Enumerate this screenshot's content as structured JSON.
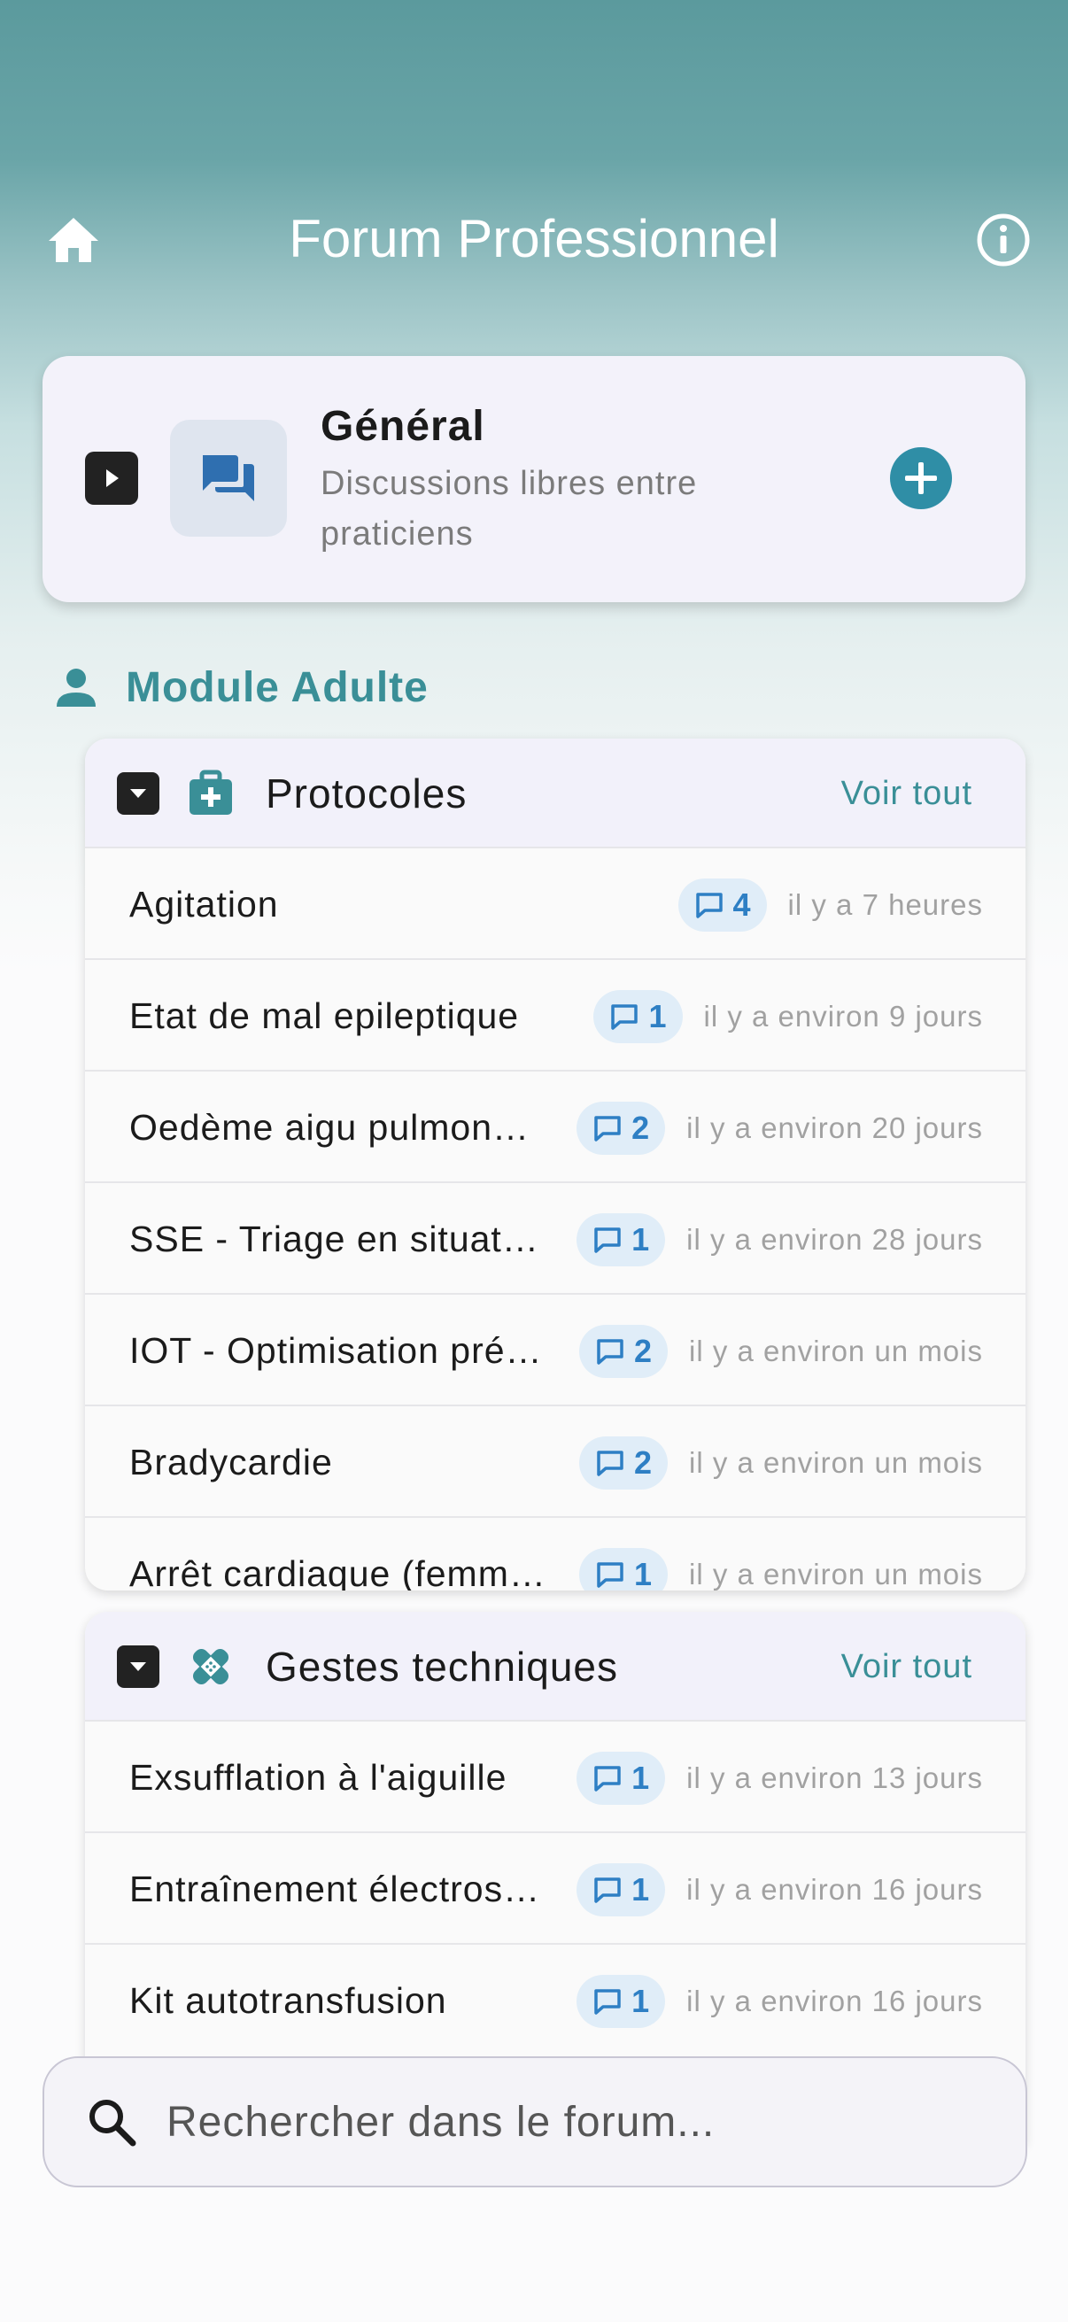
{
  "header": {
    "title": "Forum Professionnel"
  },
  "general": {
    "title": "Général",
    "description": "Discussions libres entre praticiens"
  },
  "module": {
    "title": "Module Adulte"
  },
  "protocols": {
    "title": "Protocoles",
    "see_all": "Voir tout",
    "topics": [
      {
        "title": "Agitation",
        "replies": "4",
        "time": "il y a 7 heures"
      },
      {
        "title": "Etat de mal epileptique",
        "replies": "1",
        "time": "il y a environ 9 jours"
      },
      {
        "title": "Oedème aigu pulmonaire",
        "replies": "2",
        "time": "il y a environ 20 jours"
      },
      {
        "title": "SSE - Triage en situation",
        "replies": "1",
        "time": "il y a environ 28 jours"
      },
      {
        "title": "IOT - Optimisation pré-oxygénation",
        "replies": "2",
        "time": "il y a environ un mois"
      },
      {
        "title": "Bradycardie",
        "replies": "2",
        "time": "il y a environ un mois"
      },
      {
        "title": "Arrêt cardiaque (femme enceinte)",
        "replies": "1",
        "time": "il y a environ un mois"
      }
    ]
  },
  "gestures": {
    "title": "Gestes techniques",
    "see_all": "Voir tout",
    "topics": [
      {
        "title": "Exsufflation à l'aiguille",
        "replies": "1",
        "time": "il y a environ 13 jours"
      },
      {
        "title": "Entraînement électrosystolique",
        "replies": "1",
        "time": "il y a environ 16 jours"
      },
      {
        "title": "Kit autotransfusion",
        "replies": "1",
        "time": "il y a environ 16 jours"
      }
    ]
  },
  "search": {
    "placeholder": "Rechercher dans le forum..."
  },
  "icons": {
    "home": "home-icon",
    "info": "info-icon",
    "forum": "forum-icon",
    "add": "add-circle-icon",
    "person": "person-icon",
    "medkit": "medical-bag-icon",
    "bandage": "bandage-icon",
    "comment": "comment-icon",
    "search": "search-icon"
  },
  "colors": {
    "accent": "#3a8f97",
    "add_button": "#2f8ea6",
    "badge_bg": "#e0edf8",
    "badge_text": "#2e7fc4",
    "card_bg": "#f3f2fa"
  }
}
